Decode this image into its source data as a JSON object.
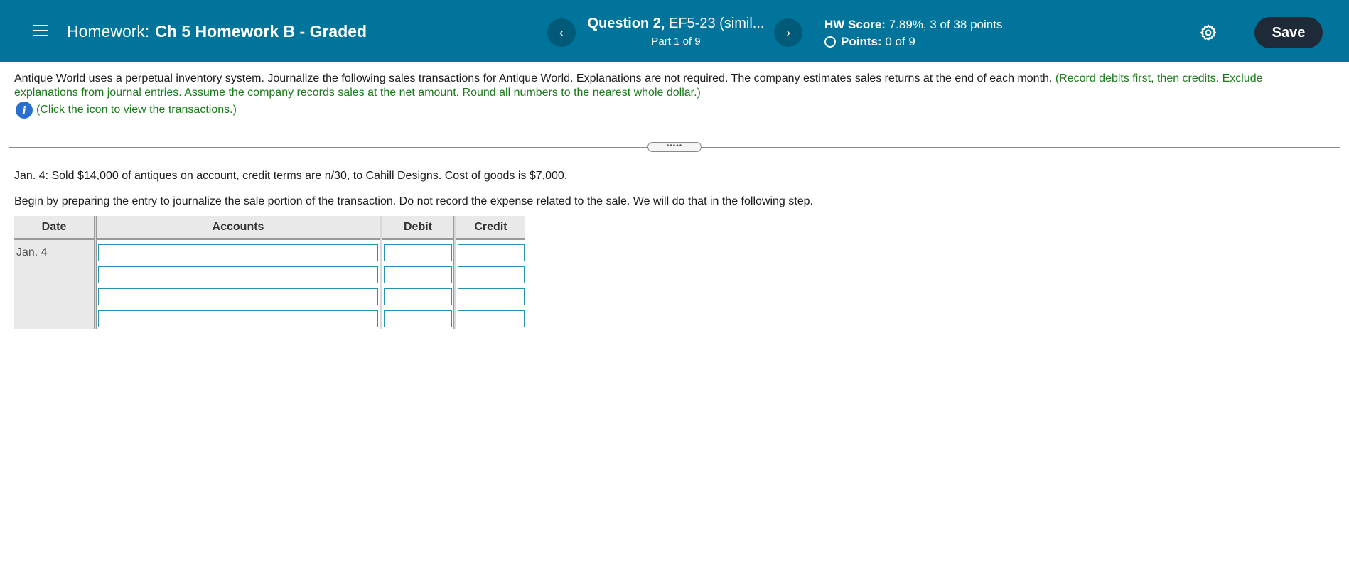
{
  "header": {
    "title_prefix": "Homework:",
    "title": "Ch 5 Homework B - Graded",
    "question_label": "Question 2,",
    "question_id": "EF5-23 (simil...",
    "part": "Part 1 of 9",
    "hw_score_label": "HW Score:",
    "hw_score_value": "7.89%, 3 of 38 points",
    "points_label": "Points:",
    "points_value": "0 of 9",
    "prev_symbol": "‹",
    "next_symbol": "›",
    "save_label": "Save",
    "colors": {
      "bar": "#00749a",
      "save": "#1f2a38"
    }
  },
  "instructions": {
    "main": "Antique World uses a perpetual inventory system. Journalize the following sales transactions for Antique World. Explanations are not required. The company estimates sales returns at the end of each month.",
    "note": "(Record debits first, then credits. Exclude explanations from journal entries. Assume the company records sales at the net amount. Round all numbers to the nearest whole dollar.)",
    "info_link": "(Click the icon to view the transactions.)"
  },
  "divider_handle": "•••••",
  "question": {
    "transaction": "Jan. 4: Sold $14,000 of antiques on account, credit terms are n/30, to Cahill Designs. Cost of goods is $7,000.",
    "step": "Begin by preparing the entry to journalize the sale portion of the transaction. Do not record the expense related to the sale. We will do that in the following step."
  },
  "journal": {
    "columns": [
      "Date",
      "Accounts",
      "Debit",
      "Credit"
    ],
    "date": "Jan. 4",
    "rows": [
      {
        "account": "",
        "debit": "",
        "credit": ""
      },
      {
        "account": "",
        "debit": "",
        "credit": ""
      },
      {
        "account": "",
        "debit": "",
        "credit": ""
      },
      {
        "account": "",
        "debit": "",
        "credit": ""
      }
    ]
  }
}
